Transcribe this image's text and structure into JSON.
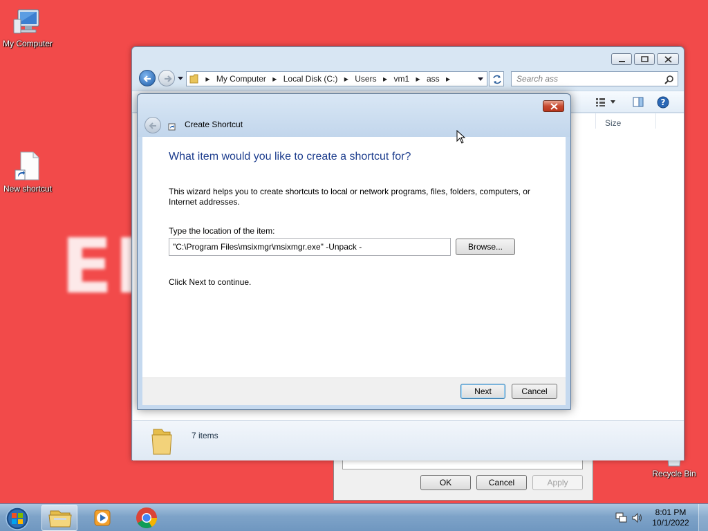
{
  "desktop": {
    "icons": [
      {
        "label": "My Computer",
        "icon": "computer-icon"
      },
      {
        "label": "New shortcut",
        "icon": "shortcut-file-icon"
      },
      {
        "label": "Recycle Bin",
        "icon": "recycle-bin-icon"
      }
    ],
    "background_color": "#f24a4a",
    "watermark_text": "EI"
  },
  "explorer": {
    "breadcrumb": [
      "My Computer",
      "Local Disk (C:)",
      "Users",
      "vm1",
      "ass"
    ],
    "search_placeholder": "Search ass",
    "column_size": "Size",
    "item_count": "7 items"
  },
  "properties_dialog": {
    "ok_label": "OK",
    "cancel_label": "Cancel",
    "apply_label": "Apply"
  },
  "wizard": {
    "title": "Create Shortcut",
    "heading": "What item would you like to create a shortcut for?",
    "description": "This wizard helps you to create shortcuts to local or network programs, files, folders, computers, or Internet addresses.",
    "location_label": "Type the location of the item:",
    "location_value": "\"C:\\Program Files\\msixmgr\\msixmgr.exe\" -Unpack -",
    "browse_label": "Browse...",
    "hint": "Click Next to continue.",
    "next_label": "Next",
    "cancel_label": "Cancel"
  },
  "taskbar": {
    "items": [
      "start-orb-icon",
      "explorer-icon",
      "media-player-icon",
      "chrome-icon"
    ],
    "time": "8:01 PM",
    "date": "10/1/2022"
  },
  "colors": {
    "accent_heading": "#1e3e8e",
    "window_frame": "#c5d9ef",
    "close_red": "#c74a30"
  }
}
